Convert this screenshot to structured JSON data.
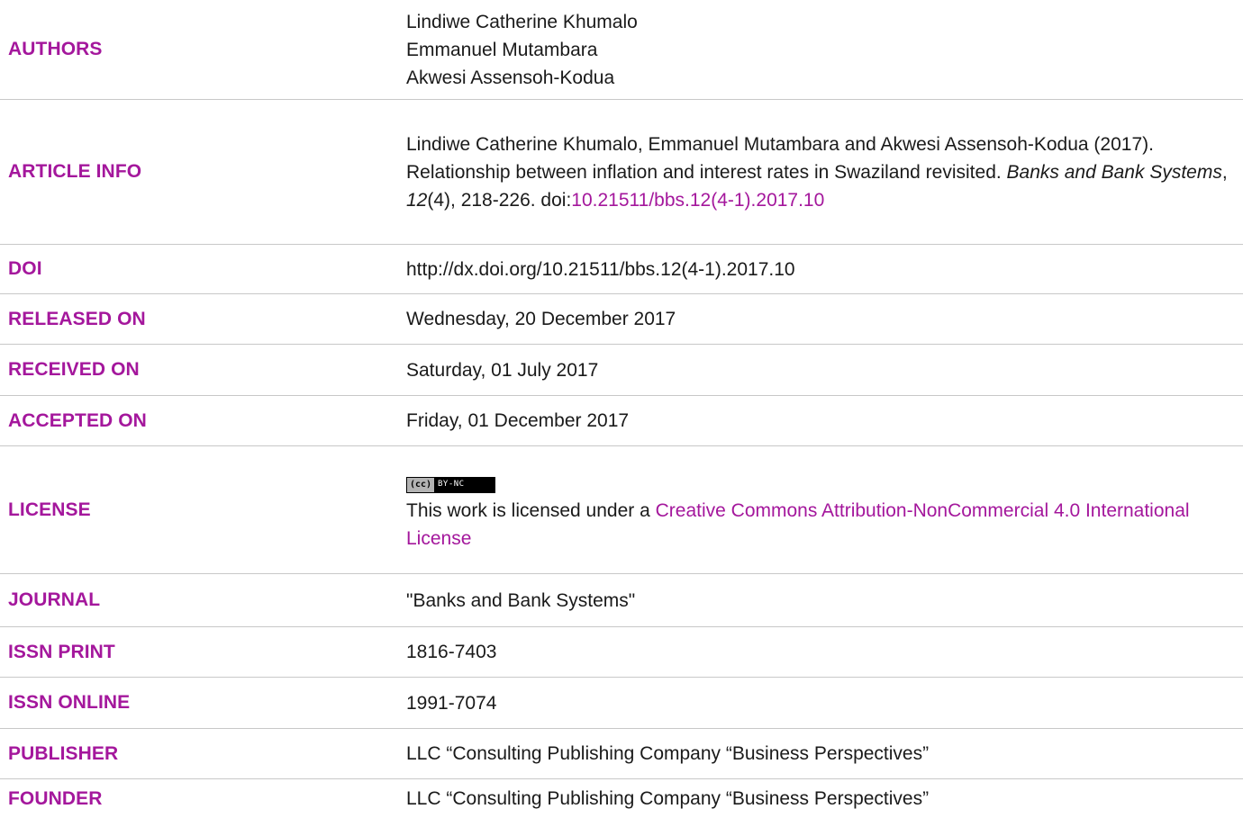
{
  "rows": {
    "authors": {
      "label": "AUTHORS",
      "names": [
        "Lindiwe Catherine Khumalo",
        "Emmanuel Mutambara",
        "Akwesi Assensoh-Kodua"
      ]
    },
    "article_info": {
      "label": "ARTICLE INFO",
      "citation_prefix": "Lindiwe Catherine Khumalo, Emmanuel Mutambara and Akwesi Assensoh-Kodua (2017). Relationship between inflation and interest rates in Swaziland revisited. ",
      "journal_italic": "Banks and Bank Systems",
      "sep1": ", ",
      "volume_italic": "12",
      "issue_pages": "(4), 218-226. doi:",
      "doi_link": "10.21511/bbs.12(4-1).2017.10"
    },
    "doi": {
      "label": "DOI",
      "value": "http://dx.doi.org/10.21511/bbs.12(4-1).2017.10"
    },
    "released_on": {
      "label": "RELEASED ON",
      "value": "Wednesday, 20 December 2017"
    },
    "received_on": {
      "label": "RECEIVED ON",
      "value": "Saturday, 01 July 2017"
    },
    "accepted_on": {
      "label": "ACCEPTED ON",
      "value": "Friday, 01 December 2017"
    },
    "license": {
      "label": "LICENSE",
      "badge_left": "(cc)",
      "badge_right": "BY-NC",
      "text_prefix": "This work is licensed under a ",
      "link_text": "Creative Commons Attribution-NonCommercial 4.0 International License"
    },
    "journal": {
      "label": "JOURNAL",
      "value": "\"Banks and Bank Systems\""
    },
    "issn_print": {
      "label": "ISSN PRINT",
      "value": "1816-7403"
    },
    "issn_online": {
      "label": "ISSN ONLINE",
      "value": "1991-7074"
    },
    "publisher": {
      "label": "PUBLISHER",
      "value": "LLC “Consulting Publishing Company “Business Perspectives”"
    },
    "founder": {
      "label": "FOUNDER",
      "value": "LLC “Consulting Publishing Company “Business Perspectives”"
    }
  },
  "colors": {
    "label_accent": "#a4179c",
    "divider": "#c8c8c8",
    "text": "#1a1a1a"
  }
}
